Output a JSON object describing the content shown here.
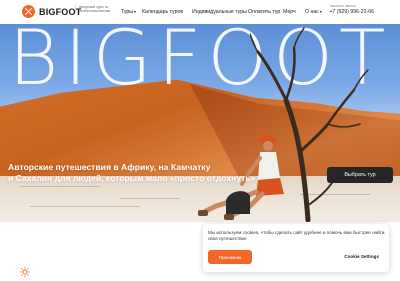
{
  "header": {
    "brand": "BIGFOOT",
    "tagline": "Авторские туры по необычным местам",
    "nav": [
      {
        "label": "Туры",
        "dropdown": true
      },
      {
        "label": "Календарь туров",
        "dropdown": false
      },
      {
        "label": "Индивидуальные туры",
        "dropdown": false
      },
      {
        "label": "Оплатить тур",
        "dropdown": false
      },
      {
        "label": "Мерч",
        "dropdown": false
      },
      {
        "label": "О нас",
        "dropdown": true
      }
    ],
    "phone_caption": "Заказать звонок",
    "phone": "+7 (929) 996-22-66"
  },
  "hero": {
    "big_word": "BIGFOOT",
    "headline_line1": "Авторские путешествия в Африку, на Камчатку",
    "headline_line2": "и Сахалин для людей, которым мало «просто отдохнуть»",
    "cta_label": "Выбрать тур"
  },
  "cookie": {
    "text": "Мы используем cookies, чтобы сделать сайт удобнее и помочь вам быстрее найти свое путешествие",
    "accept_label": "Принимаю",
    "settings_label": "Cookie Settings"
  },
  "colors": {
    "brand": "#ef6a2a",
    "cta_bg": "#262626"
  },
  "icons": {
    "logo": "bigfoot-logo-icon",
    "caret": "chevron-down-icon",
    "bottom": "sun-icon"
  }
}
